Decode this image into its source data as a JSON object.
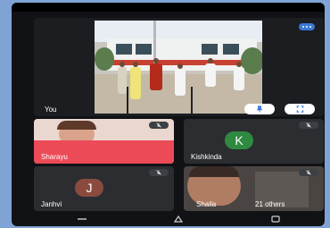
{
  "main": {
    "speaker_label": "You"
  },
  "participants": [
    {
      "name": "Sharayu"
    },
    {
      "name": "Kishkinda",
      "initial": "K",
      "avatar_color": "#2e8a40"
    },
    {
      "name": "Janhvi",
      "initial": "J",
      "avatar_color": "#8a4b3e"
    },
    {
      "name": "Shaila"
    }
  ],
  "others_count_label": "21 others",
  "icons": [
    "more-options-icon",
    "pin-icon",
    "fullscreen-icon",
    "mic-off-icon",
    "nav-recents-icon",
    "nav-home-icon",
    "nav-back-icon"
  ]
}
